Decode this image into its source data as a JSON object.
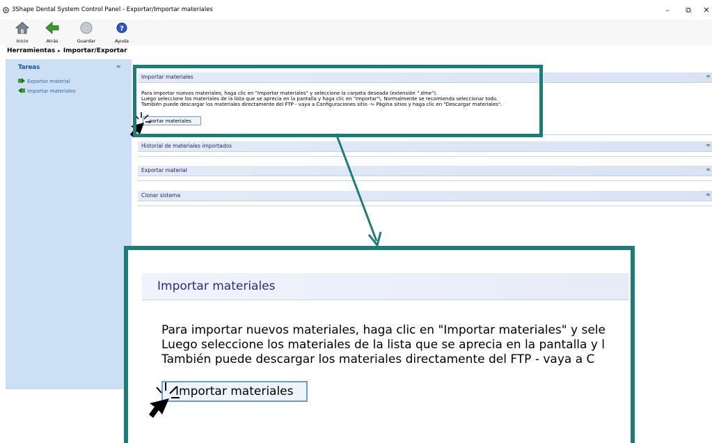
{
  "window": {
    "title": "3Shape Dental System Control Panel - Exportar/Importar materiales",
    "minimize": "–",
    "restore": "⧉",
    "close": "✕"
  },
  "toolbar": {
    "home": "Inicio",
    "back": "Atrás",
    "save": "Guardar",
    "help": "Ayuda"
  },
  "breadcrumb": {
    "root": "Herramientas",
    "separator": "▸",
    "current": "Importar/Exportar"
  },
  "sidebar": {
    "title": "Tareas",
    "collapse": "≈",
    "items": [
      {
        "label": "Exportar material",
        "icon": "export-icon"
      },
      {
        "label": "Importar materiales",
        "icon": "import-icon"
      }
    ]
  },
  "panels": {
    "import": {
      "title": "Importar materiales",
      "chevron": "≈",
      "lines": [
        "Para importar nuevos materiales, haga clic en \"Importar materiales\" y seleccione la carpeta deseada (extensión \".dme\").",
        "Luego seleccione los materiales de la lista que se aprecia en la pantalla y haga clic en \"Importar\"\\. Normalmente se recomienda seleccionar todo.",
        "También puede descargar los materiales directamente del FTP - vaya a Configuraciones sitio -> Página sitios y haga clic en \"Descargar materiales\"."
      ],
      "button": "Importar materiales",
      "button_visible": "portar materiales"
    },
    "history": {
      "title": "Historial de materiales importados",
      "chevron": "≈"
    },
    "export": {
      "title": "Exportar material",
      "chevron": "≈"
    },
    "clone": {
      "title": "Clonar sistema",
      "chevron": "≈"
    }
  },
  "zoom": {
    "title": "Importar materiales",
    "lines": [
      "Para importar nuevos materiales, haga clic en \"Importar materiales\" y sele",
      "Luego seleccione los materiales de la lista que se aprecia en la pantalla y l",
      "También puede descargar los materiales directamente del FTP - vaya a C"
    ],
    "button": "Importar materiales"
  },
  "colors": {
    "highlight": "#1d7b78",
    "sidebar_bg": "#cce0f5",
    "link": "#2d5fb8",
    "panel_title": "#202080"
  }
}
